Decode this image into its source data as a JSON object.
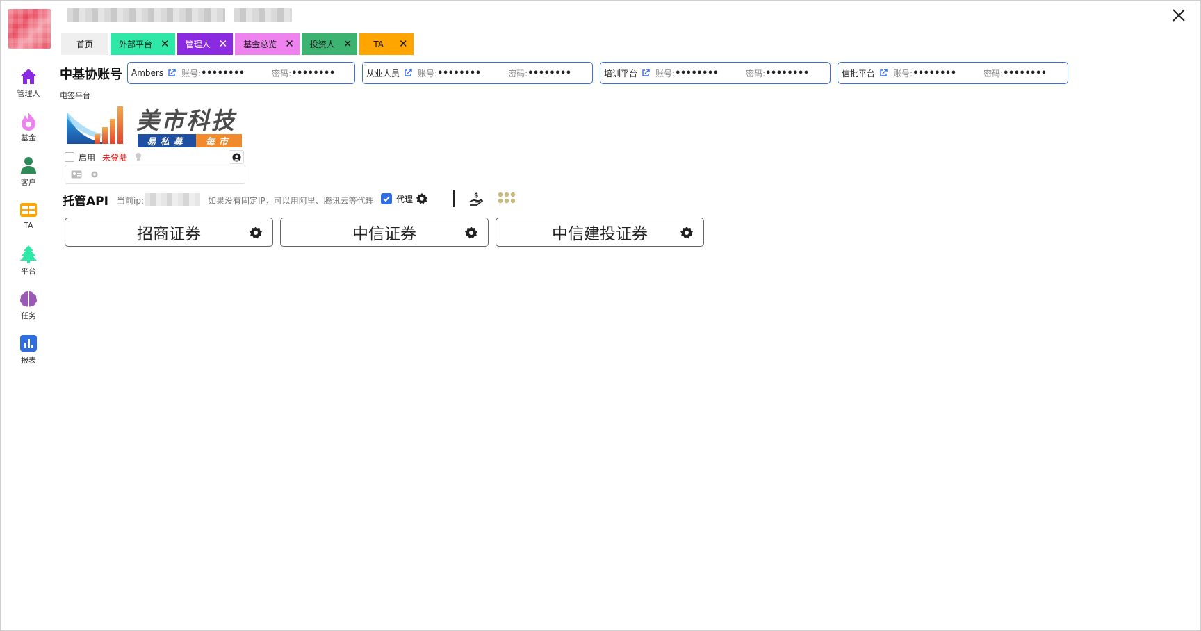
{
  "tabs": [
    {
      "label": "首页",
      "closable": false
    },
    {
      "label": "外部平台",
      "closable": true,
      "color": "#2ee8a8"
    },
    {
      "label": "管理人",
      "closable": true,
      "color": "#8a2be2"
    },
    {
      "label": "基金总览",
      "closable": true,
      "color": "#ee82ee"
    },
    {
      "label": "投资人",
      "closable": true,
      "color": "#3cb371"
    },
    {
      "label": "TA",
      "closable": true,
      "color": "#ffa500"
    }
  ],
  "tab_close_glyph": "✕",
  "sidebar": [
    {
      "label": "管理人",
      "icon": "home-icon",
      "color": "#8a2be2"
    },
    {
      "label": "基金",
      "icon": "flame-icon",
      "color": "#ee82ee"
    },
    {
      "label": "客户",
      "icon": "user-icon",
      "color": "#2e8b57"
    },
    {
      "label": "TA",
      "icon": "table-icon",
      "color": "#ffa500"
    },
    {
      "label": "平台",
      "icon": "tree-icon",
      "color": "#2ee8a8"
    },
    {
      "label": "任务",
      "icon": "brain-icon",
      "color": "#9b59b6"
    },
    {
      "label": "报表",
      "icon": "bar-chart-icon",
      "color": "#2f6de1"
    }
  ],
  "accounts": {
    "title": "中基协账号",
    "items": [
      {
        "name": "Ambers",
        "account_label": "账号:",
        "account_value": "••••••••",
        "password_label": "密码:",
        "password_value": "••••••••"
      },
      {
        "name": "从业人员",
        "account_label": "账号:",
        "account_value": "••••••••",
        "password_label": "密码:",
        "password_value": "••••••••"
      },
      {
        "name": "培训平台",
        "account_label": "账号:",
        "account_value": "••••••••",
        "password_label": "密码:",
        "password_value": "••••••••"
      },
      {
        "name": "信批平台",
        "account_label": "账号:",
        "account_value": "••••••••",
        "password_label": "密码:",
        "password_value": "••••••••"
      }
    ]
  },
  "esign": {
    "label": "电签平台",
    "brand_name": "美市科技",
    "brand_sub_left": "易私募",
    "brand_sub_right": "每市",
    "enable_label": "启用",
    "status": "未登陆",
    "status_color": "#e11111"
  },
  "api": {
    "title": "托管API",
    "ip_label": "当前ip:",
    "hint": "如果没有固定IP，可以用阿里、腾讯云等代理",
    "proxy_label": "代理",
    "proxy_checked": true,
    "brokers": [
      "招商证券",
      "中信证券",
      "中信建投证券"
    ]
  },
  "colors": {
    "accent": "#3b6fd9",
    "brand_blue": "#1e4fa0",
    "brand_orange": "#f08a2c"
  }
}
